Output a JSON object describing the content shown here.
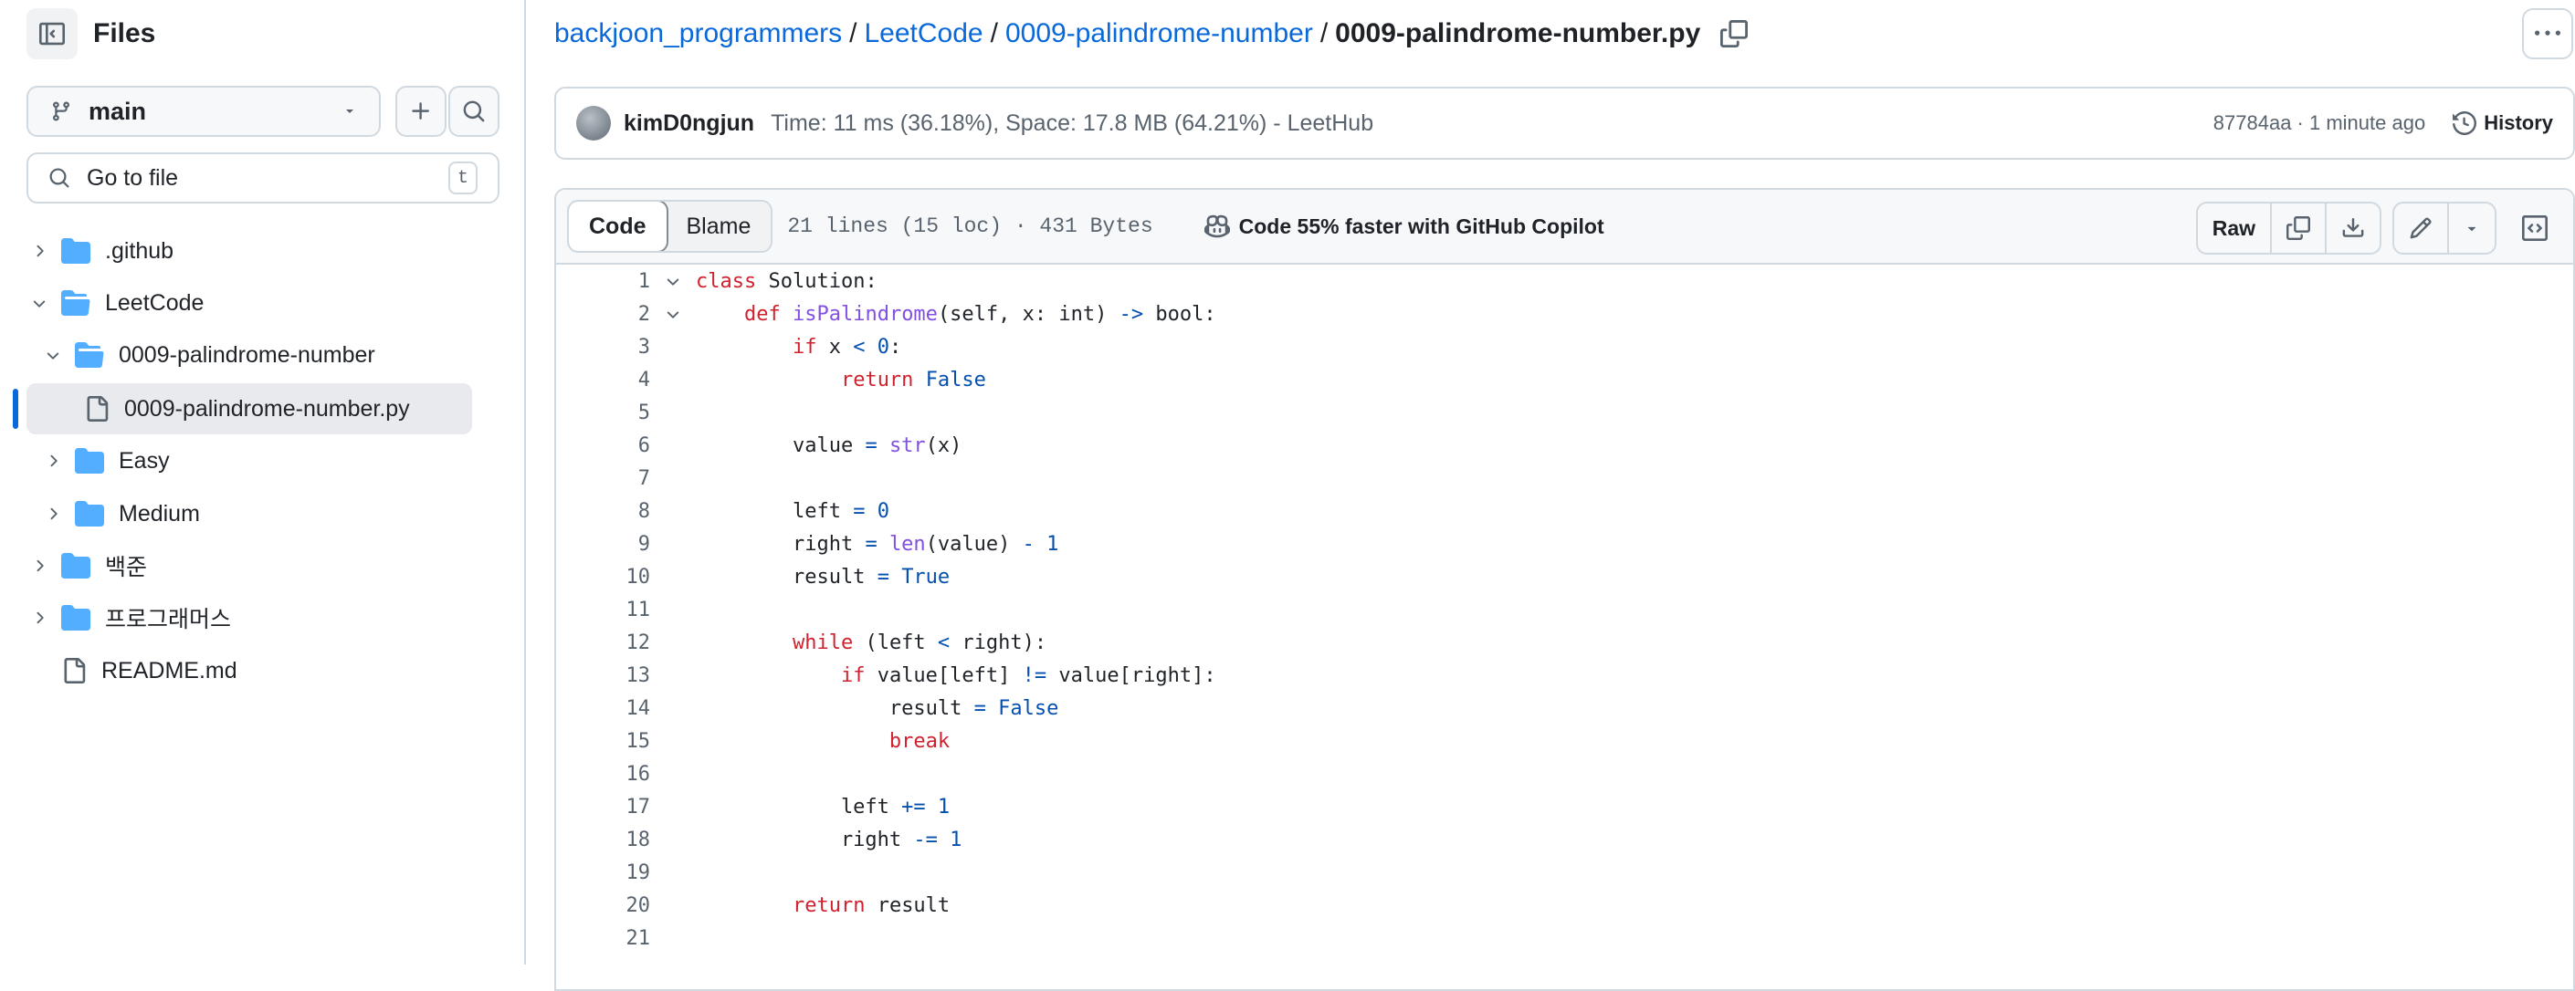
{
  "sidebar": {
    "title": "Files",
    "branch": "main",
    "search_placeholder": "Go to file",
    "search_shortcut": "t",
    "tree": [
      {
        "label": ".github",
        "type": "folder",
        "depth": 0,
        "expanded": false
      },
      {
        "label": "LeetCode",
        "type": "folder",
        "depth": 0,
        "expanded": true
      },
      {
        "label": "0009-palindrome-number",
        "type": "folder",
        "depth": 1,
        "expanded": true
      },
      {
        "label": "0009-palindrome-number.py",
        "type": "file",
        "depth": 2,
        "selected": true
      },
      {
        "label": "Easy",
        "type": "folder",
        "depth": 1,
        "expanded": false
      },
      {
        "label": "Medium",
        "type": "folder",
        "depth": 1,
        "expanded": false
      },
      {
        "label": "백준",
        "type": "folder",
        "depth": 0,
        "expanded": false
      },
      {
        "label": "프로그래머스",
        "type": "folder",
        "depth": 0,
        "expanded": false
      },
      {
        "label": "README.md",
        "type": "file",
        "depth": 0
      }
    ]
  },
  "breadcrumb": {
    "repo": "backjoon_programmers",
    "sep": "/",
    "dir1": "LeetCode",
    "dir2": "0009-palindrome-number",
    "file": "0009-palindrome-number.py"
  },
  "commit": {
    "author": "kimD0ngjun",
    "message": "Time: 11 ms (36.18%), Space: 17.8 MB (64.21%) - LeetHub",
    "meta": "87784aa · 1 minute ago",
    "history_label": "History"
  },
  "viewer": {
    "tab_code": "Code",
    "tab_blame": "Blame",
    "file_meta": "21 lines (15 loc) · 431 Bytes",
    "copilot_text": "Code 55% faster with GitHub Copilot",
    "raw_label": "Raw"
  },
  "code_lines": [
    [
      [
        "k",
        "class"
      ],
      [
        "t",
        " Solution:"
      ]
    ],
    [
      [
        "t",
        "    "
      ],
      [
        "k",
        "def"
      ],
      [
        "t",
        " "
      ],
      [
        "f",
        "isPalindrome"
      ],
      [
        "t",
        "(self, x: int) "
      ],
      [
        "c",
        "->"
      ],
      [
        "t",
        " bool:"
      ]
    ],
    [
      [
        "t",
        "        "
      ],
      [
        "k",
        "if"
      ],
      [
        "t",
        " x "
      ],
      [
        "c",
        "<"
      ],
      [
        "t",
        " "
      ],
      [
        "c",
        "0"
      ],
      [
        "t",
        ":"
      ]
    ],
    [
      [
        "t",
        "            "
      ],
      [
        "k",
        "return"
      ],
      [
        "t",
        " "
      ],
      [
        "c",
        "False"
      ]
    ],
    [],
    [
      [
        "t",
        "        value "
      ],
      [
        "c",
        "="
      ],
      [
        "t",
        " "
      ],
      [
        "f",
        "str"
      ],
      [
        "t",
        "(x)"
      ]
    ],
    [],
    [
      [
        "t",
        "        left "
      ],
      [
        "c",
        "="
      ],
      [
        "t",
        " "
      ],
      [
        "c",
        "0"
      ]
    ],
    [
      [
        "t",
        "        right "
      ],
      [
        "c",
        "="
      ],
      [
        "t",
        " "
      ],
      [
        "f",
        "len"
      ],
      [
        "t",
        "(value) "
      ],
      [
        "c",
        "-"
      ],
      [
        "t",
        " "
      ],
      [
        "c",
        "1"
      ]
    ],
    [
      [
        "t",
        "        result "
      ],
      [
        "c",
        "="
      ],
      [
        "t",
        " "
      ],
      [
        "c",
        "True"
      ]
    ],
    [],
    [
      [
        "t",
        "        "
      ],
      [
        "k",
        "while"
      ],
      [
        "t",
        " (left "
      ],
      [
        "c",
        "<"
      ],
      [
        "t",
        " right):"
      ]
    ],
    [
      [
        "t",
        "            "
      ],
      [
        "k",
        "if"
      ],
      [
        "t",
        " value[left] "
      ],
      [
        "c",
        "!="
      ],
      [
        "t",
        " value[right]:"
      ]
    ],
    [
      [
        "t",
        "                result "
      ],
      [
        "c",
        "="
      ],
      [
        "t",
        " "
      ],
      [
        "c",
        "False"
      ]
    ],
    [
      [
        "t",
        "                "
      ],
      [
        "k",
        "break"
      ]
    ],
    [],
    [
      [
        "t",
        "            left "
      ],
      [
        "c",
        "+="
      ],
      [
        "t",
        " "
      ],
      [
        "c",
        "1"
      ]
    ],
    [
      [
        "t",
        "            right "
      ],
      [
        "c",
        "-="
      ],
      [
        "t",
        " "
      ],
      [
        "c",
        "1"
      ]
    ],
    [],
    [
      [
        "t",
        "        "
      ],
      [
        "k",
        "return"
      ],
      [
        "t",
        " result"
      ]
    ],
    []
  ],
  "folded_lines": [
    1,
    2
  ],
  "colors": {
    "accent": "#0969da",
    "keyword": "#cf222e",
    "function": "#8250df",
    "constant": "#0550ae",
    "folder": "#54aeff",
    "muted": "#59636e"
  }
}
